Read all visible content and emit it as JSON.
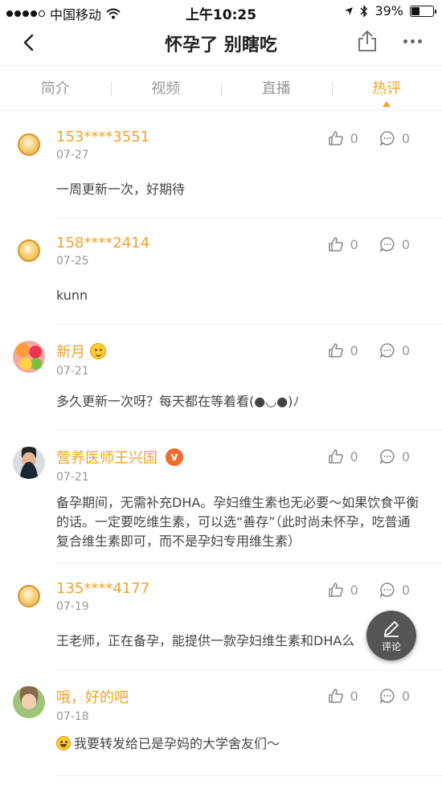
{
  "status_bar": {
    "carrier": "中国移动",
    "time": "上午10:25",
    "battery": "39%",
    "battery_level": 0.39
  },
  "nav": {
    "title": "怀孕了 别瞎吃"
  },
  "tabs": [
    {
      "label": "简介"
    },
    {
      "label": "视频"
    },
    {
      "label": "直播"
    },
    {
      "label": "热评",
      "active": true
    }
  ],
  "comments": [
    {
      "avatar": "default-avatar",
      "username": "153****3551",
      "date": "07-27",
      "likes": "0",
      "replies": "0",
      "text": "一周更新一次，好期待"
    },
    {
      "avatar": "default-avatar",
      "username": "158****2414",
      "date": "07-25",
      "likes": "0",
      "replies": "0",
      "text": "kunn"
    },
    {
      "avatar": "fruit-avatar",
      "username": "新月",
      "badge": "smiley-emoji",
      "date": "07-21",
      "likes": "0",
      "replies": "0",
      "text": "多久更新一次呀？每天都在等着看(●◡●)ﾉ"
    },
    {
      "avatar": "doctor-avatar",
      "username": "营养医师王兴国",
      "badge": "v",
      "date": "07-21",
      "likes": "0",
      "replies": "0",
      "text": "备孕期间，无需补充DHA。孕妇维生素也无必要～如果饮食平衡的话。一定要吃维生素，可以选“善存”（此时尚未怀孕，吃普通复合维生素即可，而不是孕妇专用维生素）"
    },
    {
      "avatar": "default-avatar",
      "username": "135****4177",
      "date": "07-19",
      "likes": "0",
      "replies": "0",
      "text": "王老师，正在备孕，能提供一款孕妇维生素和DHA么"
    },
    {
      "avatar": "kid-avatar",
      "username": "哦，好的吧",
      "date": "07-18",
      "likes": "0",
      "replies": "0",
      "text": "我要转发给已是孕妈的大学舍友们～"
    }
  ],
  "fab": {
    "label": "评论"
  },
  "colors": {
    "accent": "#f0a328",
    "verified": "#f06d2b"
  }
}
